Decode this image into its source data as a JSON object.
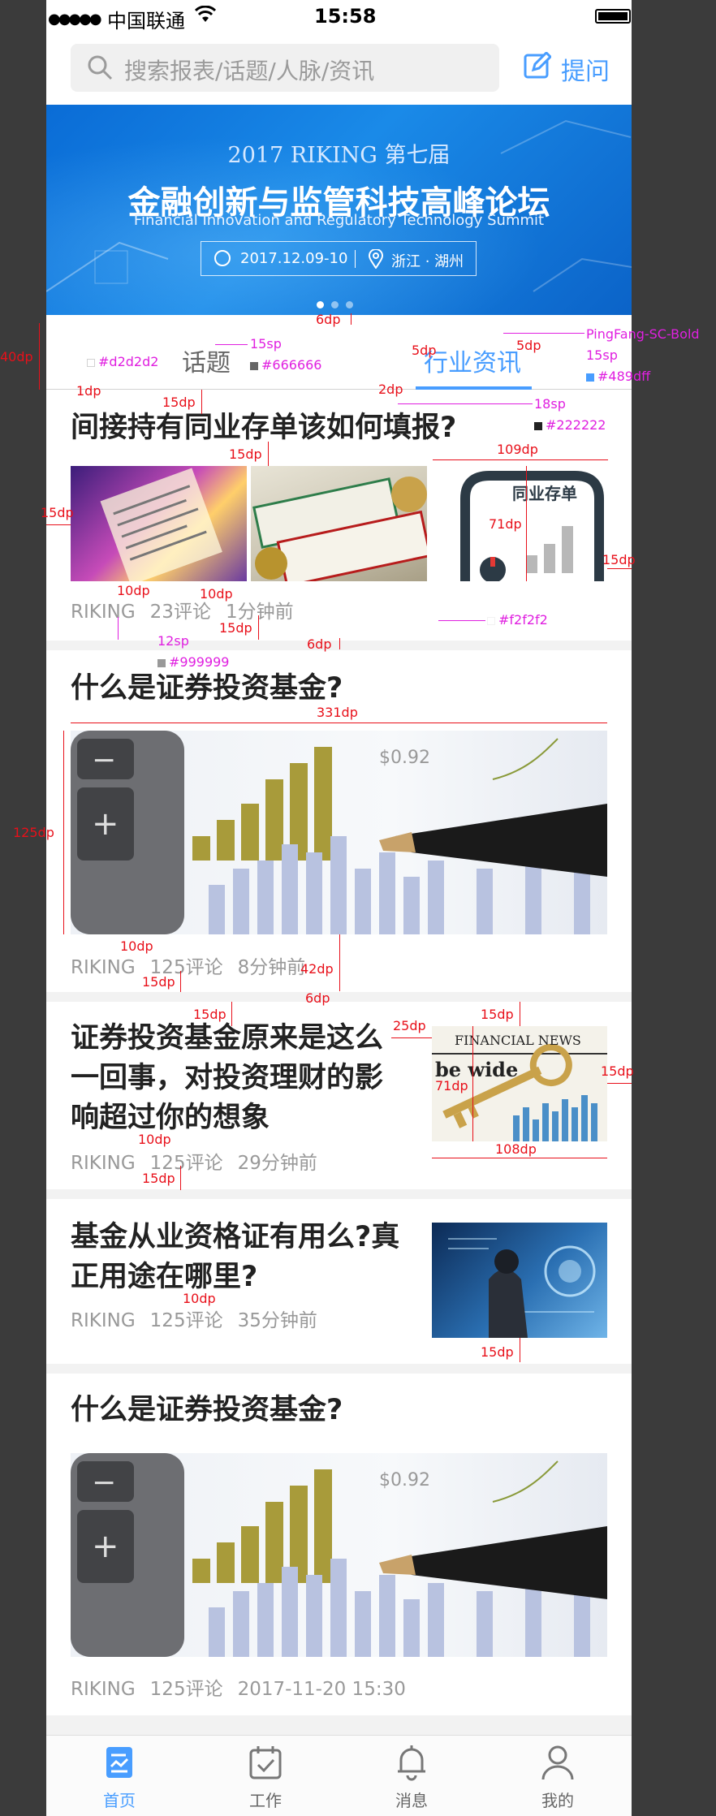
{
  "status": {
    "carrier": "中国联通",
    "time": "15:58"
  },
  "search": {
    "placeholder": "搜索报表/话题/人脉/资讯",
    "ask_label": "提问"
  },
  "banner": {
    "year_line": "2017 RIKING 第七届",
    "title": "金融创新与监管科技高峰论坛",
    "subtitle": "Financial Innovation and Regulatory Technology Summit",
    "date": "2017.12.09-10",
    "place": "浙江 · 湖州",
    "slides": 3,
    "active_slide": 1
  },
  "tabs": [
    {
      "label": "话题",
      "active": false
    },
    {
      "label": "行业资讯",
      "active": true
    }
  ],
  "articles": [
    {
      "title": "间接持有同业存单该如何填报?",
      "source": "RIKING",
      "comments": "23评论",
      "time": "1分钟前",
      "images": [
        "receipt-image",
        "bank-cards-image",
        "deposit-chart-image"
      ],
      "image_caption": "同业存单"
    },
    {
      "title": "什么是证券投资基金?",
      "source": "RIKING",
      "comments": "125评论",
      "time": "8分钟前",
      "images": [
        "calculator-pen-chart-image"
      ]
    },
    {
      "title": "证券投资基金原来是这么一回事，对投资理财的影响超过你的想象",
      "source": "RIKING",
      "comments": "125评论",
      "time": "29分钟前",
      "images": [
        "key-newspaper-image"
      ],
      "image_caption": "FINANCIAL NEWS"
    },
    {
      "title": "基金从业资格证有用么?真正用途在哪里?",
      "source": "RIKING",
      "comments": "125评论",
      "time": "35分钟前",
      "images": [
        "businessman-screen-image"
      ]
    },
    {
      "title": "什么是证券投资基金?",
      "source": "RIKING",
      "comments": "125评论",
      "time": "2017-11-20 15:30",
      "images": [
        "calculator-pen-chart-image"
      ]
    }
  ],
  "tabbar": [
    {
      "label": "首页",
      "icon": "home-doc-icon",
      "active": true
    },
    {
      "label": "工作",
      "icon": "calendar-check-icon",
      "active": false
    },
    {
      "label": "消息",
      "icon": "bell-icon",
      "active": false
    },
    {
      "label": "我的",
      "icon": "person-icon",
      "active": false
    }
  ],
  "colors": {
    "accent": "#489dff",
    "title_text": "#222222",
    "tab_text": "#666666",
    "meta_text": "#999999",
    "divider": "#f2f2f2",
    "line": "#d2d2d2",
    "annotation_red": "#e8101a",
    "annotation_magenta": "#e020e0"
  },
  "annotations": {
    "a1": "6dp",
    "a2": "40dp",
    "a3": "#d2d2d2",
    "a4": "15sp",
    "a5": "#666666",
    "a6": "5dp",
    "a7": "5dp",
    "a8": "PingFang-SC-Bold",
    "a9": "15sp",
    "a10": "#489dff",
    "a11": "1dp",
    "a12": "15dp",
    "a13": "2dp",
    "a14": "18sp",
    "a15": "#222222",
    "a16": "15dp",
    "a17": "109dp",
    "a18": "15dp",
    "a19": "71dp",
    "a20": "15dp",
    "a21": "10dp",
    "a22": "10dp",
    "a23": "#f2f2f2",
    "a24": "15dp",
    "a25": "6dp",
    "a26": "12sp",
    "a27": "#999999",
    "a28": "331dp",
    "a29": "125dp",
    "a30": "10dp",
    "a31": "42dp",
    "a32": "15dp",
    "a33": "6dp",
    "a34": "15dp",
    "a35": "25dp",
    "a36": "15dp",
    "a37": "71dp",
    "a38": "15dp",
    "a39": "10dp",
    "a40": "108dp",
    "a41": "15dp",
    "a42": "10dp",
    "a43": "15dp"
  }
}
